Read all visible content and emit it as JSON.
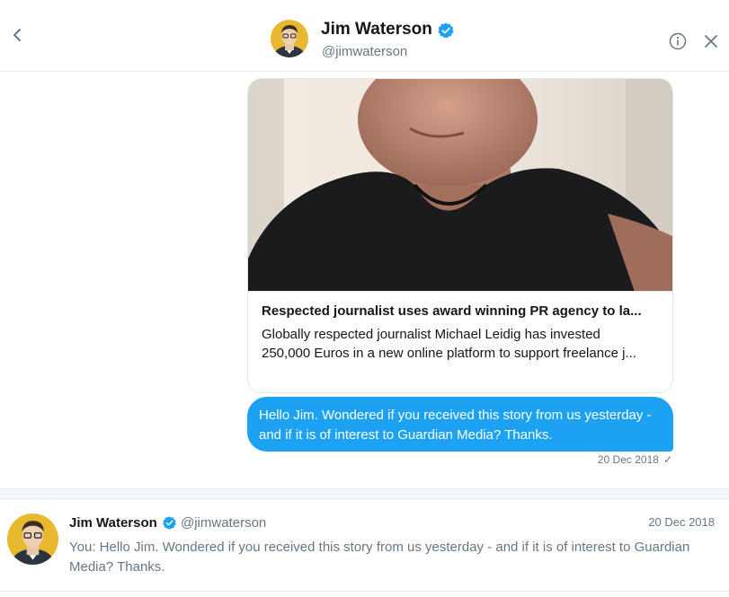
{
  "header": {
    "name": "Jim Waterson",
    "handle": "@jimwaterson",
    "icons": {
      "back": "chevron-left-icon",
      "verified": "verified-badge-icon",
      "info": "info-icon",
      "close": "close-icon"
    }
  },
  "link_card": {
    "title": "Respected journalist uses award winning PR agency to la...",
    "description_line1": "Globally respected journalist Michael Leidig has invested",
    "description_line2": "250,000 Euros in a new online platform to support freelance j..."
  },
  "message": {
    "text": "Hello Jim. Wondered if you received this story from us yesterday - and if it is of interest to Guardian Media? Thanks.",
    "timestamp": "20 Dec 2018",
    "status_icon": "checkmark-icon"
  },
  "conversation": {
    "name": "Jim Waterson",
    "handle": "@jimwaterson",
    "date": "20 Dec 2018",
    "preview": "You: Hello Jim. Wondered if you received this story from us yesterday - and if it is of interest to Guardian Media? Thanks."
  },
  "colors": {
    "accent": "#1da1f2",
    "text_primary": "#14171a",
    "text_secondary": "#657786",
    "border": "#e6ecf0"
  }
}
